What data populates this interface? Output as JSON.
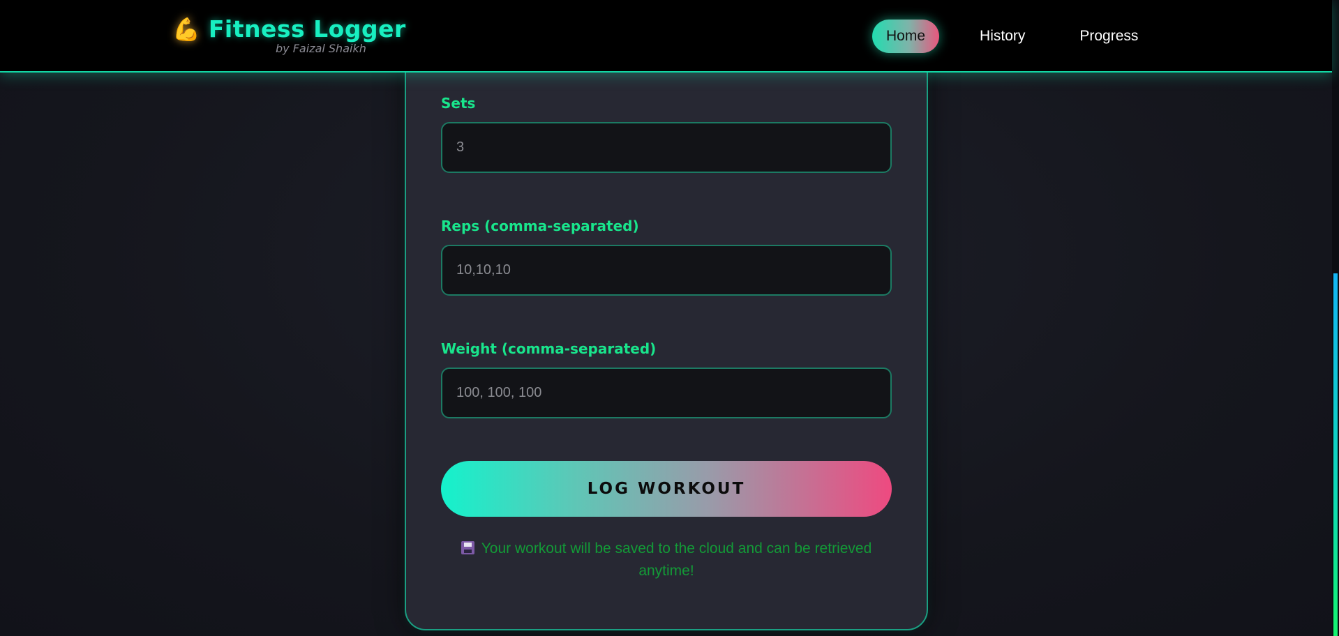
{
  "header": {
    "icon": "flexed-biceps-icon",
    "title": "Fitness Logger",
    "subtitle": "by Faizal Shaikh",
    "nav": [
      {
        "label": "Home",
        "active": true
      },
      {
        "label": "History",
        "active": false
      },
      {
        "label": "Progress",
        "active": false
      }
    ]
  },
  "form": {
    "sets": {
      "label": "Sets",
      "placeholder": "3",
      "value": ""
    },
    "reps": {
      "label": "Reps (comma-separated)",
      "placeholder": "10,10,10",
      "value": ""
    },
    "weight": {
      "label": "Weight (comma-separated)",
      "placeholder": "100, 100, 100",
      "value": ""
    },
    "submit_label": "LOG WORKOUT",
    "note_icon": "floppy-disk-icon",
    "note": "Your workout will be saved to the cloud and can be retrieved anytime!"
  },
  "colors": {
    "accent": "#18efc1",
    "label_green": "#19e58c",
    "gradient_pink": "#ee4a80",
    "note_green": "#139a37",
    "background": "#15161d"
  }
}
